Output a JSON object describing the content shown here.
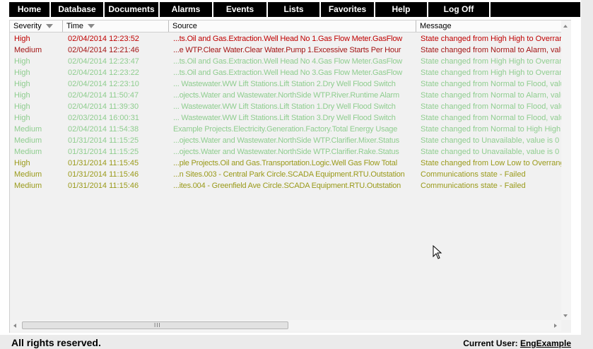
{
  "nav": {
    "items": [
      "Home",
      "Database",
      "Documents",
      "Alarms",
      "Events",
      "Lists",
      "Favorites",
      "Help",
      "Log Off"
    ]
  },
  "table": {
    "columns": [
      "Severity",
      "Time",
      "Source",
      "Message"
    ],
    "rows": [
      {
        "severity": "High",
        "time": "02/04/2014 12:23:52",
        "source": "...ts.Oil and Gas.Extraction.Well Head No 1.Gas Flow Meter.GasFlow",
        "message": "State changed from High High to Overrange",
        "color": "#c00000"
      },
      {
        "severity": "Medium",
        "time": "02/04/2014 12:21:46",
        "source": "...e WTP.Clear Water.Clear Water.Pump 1.Excessive Starts Per Hour",
        "message": "State changed from Normal to Alarm, value",
        "color": "#a31515"
      },
      {
        "severity": "High",
        "time": "02/04/2014 12:23:47",
        "source": "...ts.Oil and Gas.Extraction.Well Head No 4.Gas Flow Meter.GasFlow",
        "message": "State changed from High High to Overrange",
        "color": "#8fcd8f"
      },
      {
        "severity": "High",
        "time": "02/04/2014 12:23:22",
        "source": "...ts.Oil and Gas.Extraction.Well Head No 3.Gas Flow Meter.GasFlow",
        "message": "State changed from High High to Overrange",
        "color": "#8fcd8f"
      },
      {
        "severity": "High",
        "time": "02/04/2014 12:23:10",
        "source": "... Wastewater.WW Lift Stations.Lift Station 2.Dry Well Flood Switch",
        "message": "State changed from Normal to Flood, value",
        "color": "#8fcd8f"
      },
      {
        "severity": "High",
        "time": "02/04/2014 11:50:47",
        "source": "...ojects.Water and Wastewater.NorthSide WTP.River.Runtime Alarm",
        "message": "State changed from Normal to Alarm, value",
        "color": "#8fcd8f"
      },
      {
        "severity": "High",
        "time": "02/04/2014 11:39:30",
        "source": "... Wastewater.WW Lift Stations.Lift Station 1.Dry Well Flood Switch",
        "message": "State changed from Normal to Flood, value",
        "color": "#8fcd8f"
      },
      {
        "severity": "High",
        "time": "02/03/2014 16:00:31",
        "source": "... Wastewater.WW Lift Stations.Lift Station 3.Dry Well Flood Switch",
        "message": "State changed from Normal to Flood, value",
        "color": "#8fcd8f"
      },
      {
        "severity": "Medium",
        "time": "02/04/2014 11:54:38",
        "source": "Example Projects.Electricity.Generation.Factory.Total Energy Usage",
        "message": "State changed from Normal to High High",
        "color": "#8fcd8f"
      },
      {
        "severity": "Medium",
        "time": "01/31/2014 11:15:25",
        "source": "...ojects.Water and Wastewater.NorthSide WTP.Clarifier.Mixer.Status",
        "message": "State changed to Unavailable, value is 0",
        "color": "#8fcd8f"
      },
      {
        "severity": "Medium",
        "time": "01/31/2014 11:15:25",
        "source": "...ojects.Water and Wastewater.NorthSide WTP.Clarifier.Rake.Status",
        "message": "State changed to Unavailable, value is 0",
        "color": "#8fcd8f"
      },
      {
        "severity": "High",
        "time": "01/31/2014 11:15:45",
        "source": "...ple Projects.Oil and Gas.Transportation.Logic.Well Gas Flow Total",
        "message": "State changed from Low Low to Overrange",
        "color": "#9a9a1a"
      },
      {
        "severity": "Medium",
        "time": "01/31/2014 11:15:46",
        "source": "...n Sites.003 - Central Park Circle.SCADA Equipment.RTU.Outstation",
        "message": "Communications state - Failed",
        "color": "#9a9a1a"
      },
      {
        "severity": "Medium",
        "time": "01/31/2014 11:15:46",
        "source": "...ites.004 - Greenfield Ave Circle.SCADA Equipment.RTU.Outstation",
        "message": "Communications state - Failed",
        "color": "#9a9a1a"
      }
    ]
  },
  "scroll": {
    "grip": "III"
  },
  "footer": {
    "copyright": "All rights reserved.",
    "user_label": "Current User:",
    "user_name": "EngExample"
  }
}
